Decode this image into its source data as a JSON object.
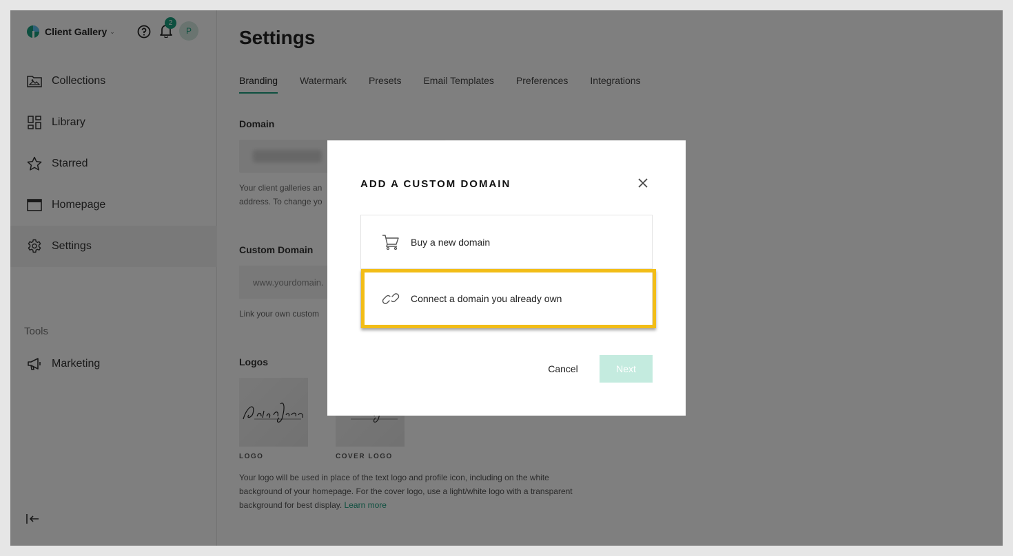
{
  "sidebar": {
    "brand": "Client Gallery",
    "notifications_count": "2",
    "avatar_initial": "P",
    "items": [
      {
        "label": "Collections",
        "icon": "image-folder-icon"
      },
      {
        "label": "Library",
        "icon": "grid-icon"
      },
      {
        "label": "Starred",
        "icon": "star-icon"
      },
      {
        "label": "Homepage",
        "icon": "window-icon"
      },
      {
        "label": "Settings",
        "icon": "gear-icon",
        "active": true
      }
    ],
    "tools_label": "Tools",
    "tools": [
      {
        "label": "Marketing",
        "icon": "megaphone-icon"
      }
    ]
  },
  "main": {
    "title": "Settings",
    "tabs": [
      {
        "label": "Branding",
        "active": true
      },
      {
        "label": "Watermark"
      },
      {
        "label": "Presets"
      },
      {
        "label": "Email Templates"
      },
      {
        "label": "Preferences"
      },
      {
        "label": "Integrations"
      }
    ],
    "domain": {
      "label": "Domain",
      "help_line1": "Your client galleries an",
      "help_line2": "address. To change yo"
    },
    "custom_domain": {
      "label": "Custom Domain",
      "placeholder": "www.yourdomain.",
      "help": "Link your own custom"
    },
    "logos": {
      "label": "Logos",
      "logo_caption": "LOGO",
      "cover_caption": "COVER LOGO",
      "description": "Your logo will be used in place of the text logo and profile icon, including on the white background of your homepage. For the cover logo, use a light/white logo with a transparent background for best display.",
      "learn_more": "Learn more"
    }
  },
  "modal": {
    "title": "ADD A CUSTOM DOMAIN",
    "options": [
      {
        "label": "Buy a new domain",
        "icon": "cart-icon"
      },
      {
        "label": "Connect a domain you already own",
        "icon": "link-icon"
      }
    ],
    "cancel": "Cancel",
    "next": "Next"
  },
  "colors": {
    "accent": "#1a9e7f",
    "highlight": "#f2bd17",
    "next_disabled": "#c4ebdf"
  }
}
